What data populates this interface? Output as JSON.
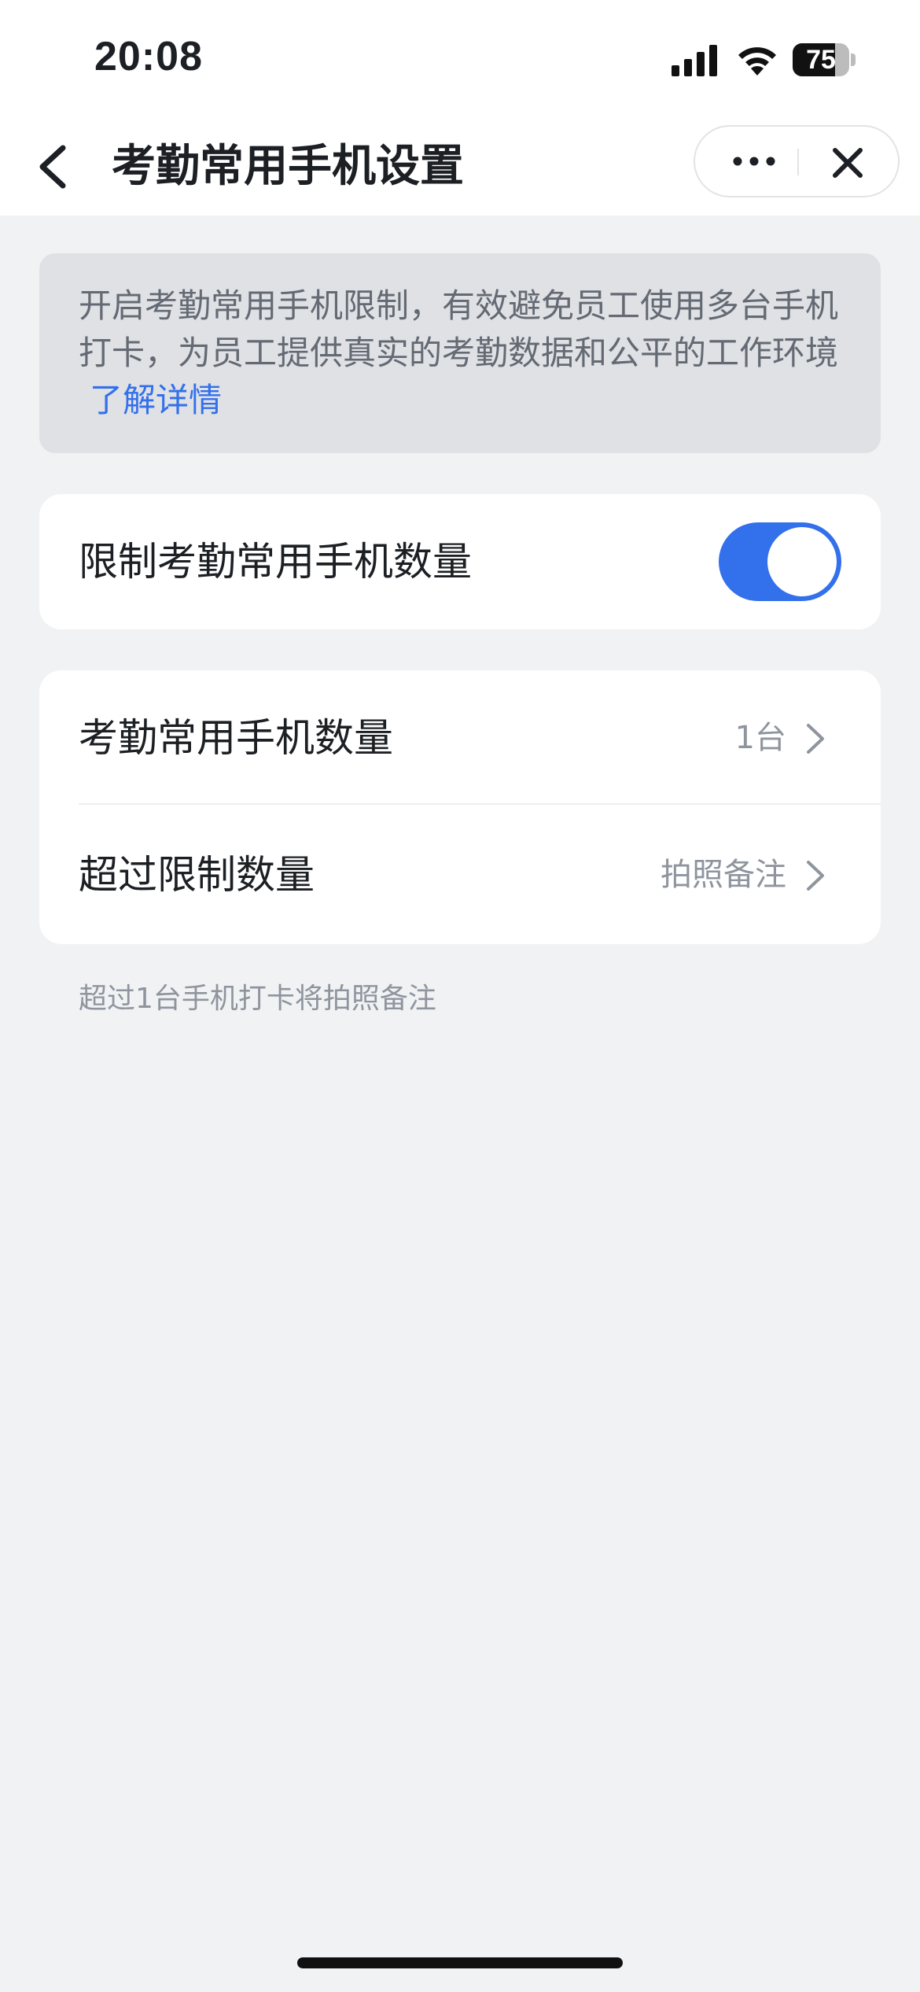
{
  "status_bar": {
    "time": "20:08",
    "battery": "75",
    "battery_level": 0.75
  },
  "nav": {
    "title": "考勤常用手机设置"
  },
  "notice": {
    "text": "开启考勤常用手机限制，有效避免员工使用多台手机打卡，为员工提供真实的考勤数据和公平的工作环境",
    "link": "了解详情"
  },
  "toggle": {
    "label": "限制考勤常用手机数量",
    "enabled": true
  },
  "settings": {
    "items": [
      {
        "label": "考勤常用手机数量",
        "value": "1台"
      },
      {
        "label": "超过限制数量",
        "value": "拍照备注"
      }
    ]
  },
  "footnote": "超过1台手机打卡将拍照备注",
  "colors": {
    "accent": "#3370eb",
    "background": "#f1f2f4",
    "notice_bg": "#dfe1e5"
  }
}
